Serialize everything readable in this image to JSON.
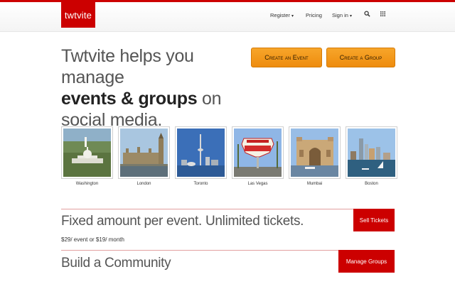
{
  "brand": {
    "logo_text": "twtvite",
    "color": "#cc0000"
  },
  "nav": {
    "register": "Register",
    "pricing": "Pricing",
    "sign_in": "Sign in",
    "caret": "▾",
    "search_icon": "search-icon",
    "grid_icon": "grid-icon"
  },
  "hero": {
    "line1": "Twtvite helps you manage",
    "bold": "events & groups",
    "mid": " on",
    "line3": "social media."
  },
  "cta": {
    "create_event": "Create an Event",
    "create_group": "Create a Group",
    "color": "#f39c1e"
  },
  "cities": [
    {
      "label": "Washington"
    },
    {
      "label": "London"
    },
    {
      "label": "Toronto"
    },
    {
      "label": "Las Vegas"
    },
    {
      "label": "Mumbai"
    },
    {
      "label": "Boston"
    }
  ],
  "sections": {
    "tickets": {
      "title": "Fixed amount per event. Unlimited tickets.",
      "price": "$29/ event or $19/ month",
      "button": "Sell Tickets"
    },
    "community": {
      "title": "Build a Community",
      "button": "Manage Groups"
    }
  }
}
